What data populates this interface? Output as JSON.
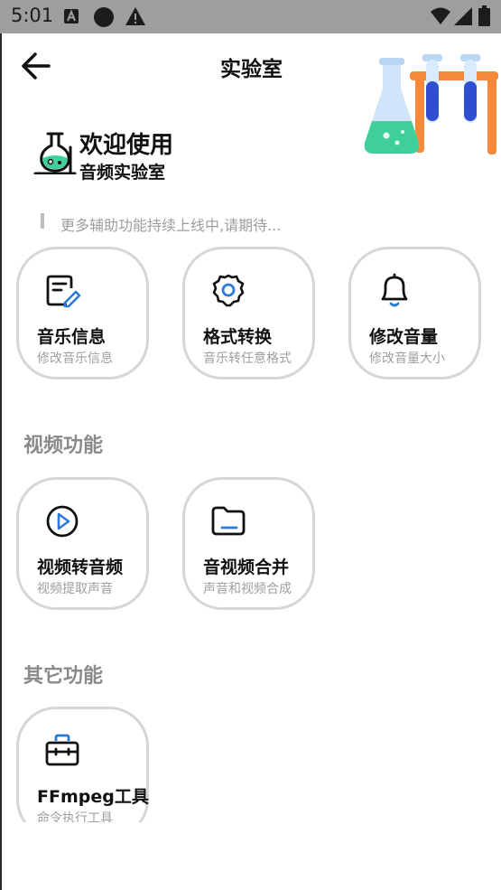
{
  "status_bar": {
    "time": "5:01",
    "left_icons": [
      "a-notification-icon",
      "dot-notification-icon",
      "warning-icon"
    ],
    "right_icons": [
      "wifi-icon",
      "signal-icon",
      "battery-icon"
    ]
  },
  "app_bar": {
    "title": "实验室"
  },
  "welcome": {
    "title": "欢迎使用",
    "subtitle": "音频实验室"
  },
  "notice": "更多辅助功能持续上线中,请期待...",
  "audio_cards": [
    {
      "title": "音乐信息",
      "subtitle": "修改音乐信息",
      "icon": "edit-note-icon"
    },
    {
      "title": "格式转换",
      "subtitle": "音乐转任意格式",
      "icon": "gear-icon"
    },
    {
      "title": "修改音量",
      "subtitle": "修改音量大小",
      "icon": "bell-icon"
    }
  ],
  "sections": {
    "video": "视频功能",
    "other": "其它功能"
  },
  "video_cards": [
    {
      "title": "视频转音频",
      "subtitle": "视频提取声音",
      "icon": "play-circle-icon"
    },
    {
      "title": "音视频合并",
      "subtitle": "声音和视频合成",
      "icon": "folder-icon"
    }
  ],
  "other_cards": [
    {
      "title": "FFmpeg工具",
      "subtitle": "命令执行工具",
      "icon": "toolbox-icon"
    }
  ],
  "colors": {
    "status_bar": "#9e9e9e",
    "accent_blue": "#2b7bd8",
    "hero_green": "#3fcf9b",
    "hero_orange": "#f5883a",
    "card_border": "#d6d6d6"
  }
}
